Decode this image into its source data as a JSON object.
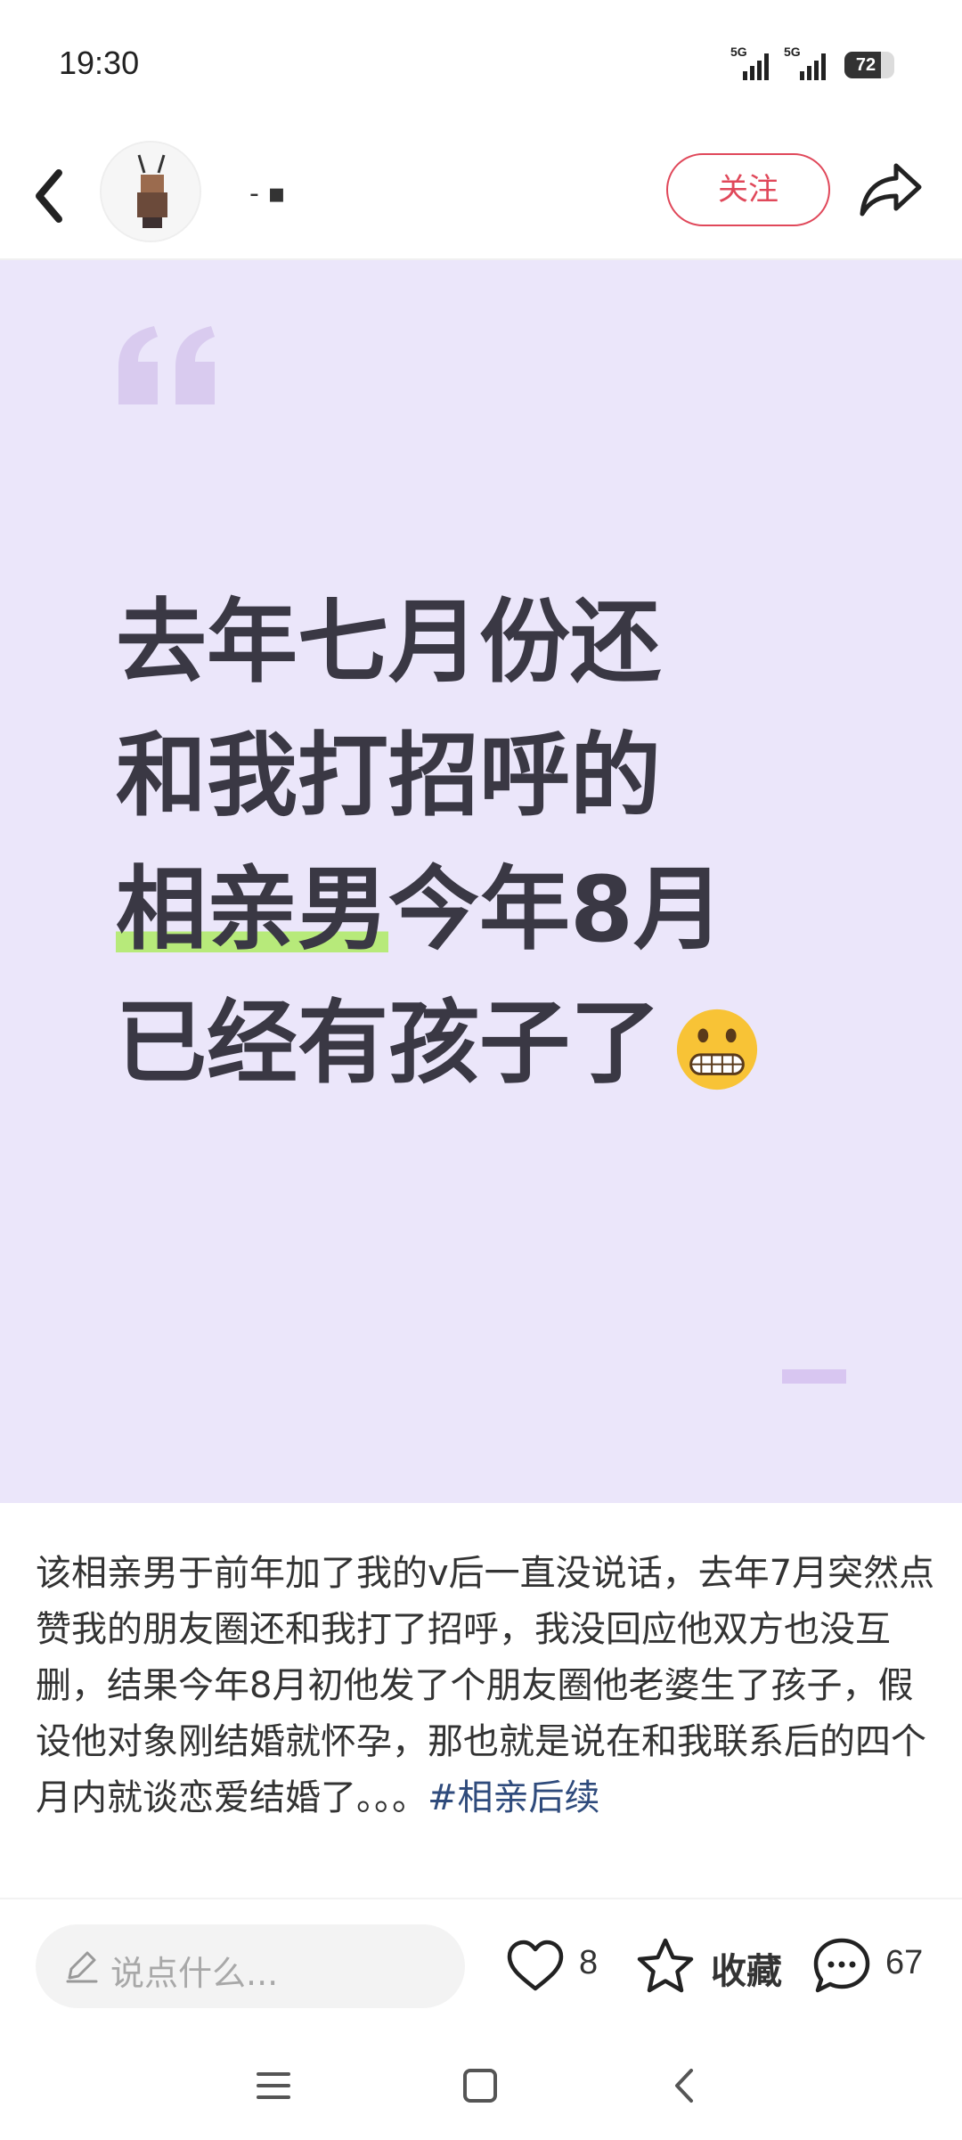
{
  "status_bar": {
    "time": "19:30",
    "signal_1_label": "5G",
    "signal_2_label": "5G",
    "battery": "72"
  },
  "header": {
    "username": "- ▪",
    "follow_label": "关注"
  },
  "post_image": {
    "headline_line1": "去年七月份还",
    "headline_line2": "和我打招呼的",
    "headline_line3_highlight": "相亲男",
    "headline_line3_rest": "今年8月",
    "headline_line4": "已经有孩子了"
  },
  "body": {
    "text": "该相亲男于前年加了我的v后一直没说话，去年7月突然点赞我的朋友圈还和我打了招呼，我没回应他双方也没互删，结果今年8月初他发了个朋友圈他老婆生了孩子，假设他对象刚结婚就怀孕，那也就是说在和我联系后的四个月内就谈恋爱结婚了。。。",
    "hashtag": "#相亲后续"
  },
  "action_bar": {
    "comment_placeholder": "说点什么...",
    "likes": "8",
    "collect_label": "收藏",
    "comments": "67"
  },
  "colors": {
    "accent": "#e0485a",
    "card_bg": "#ebe6fa",
    "highlight": "#b7ea7a",
    "hashtag": "#2f4b7c"
  },
  "icons": [
    "back-icon",
    "share-icon",
    "pencil-icon",
    "heart-icon",
    "star-icon",
    "comment-icon",
    "menu-icon",
    "home-icon",
    "nav-back-icon"
  ]
}
